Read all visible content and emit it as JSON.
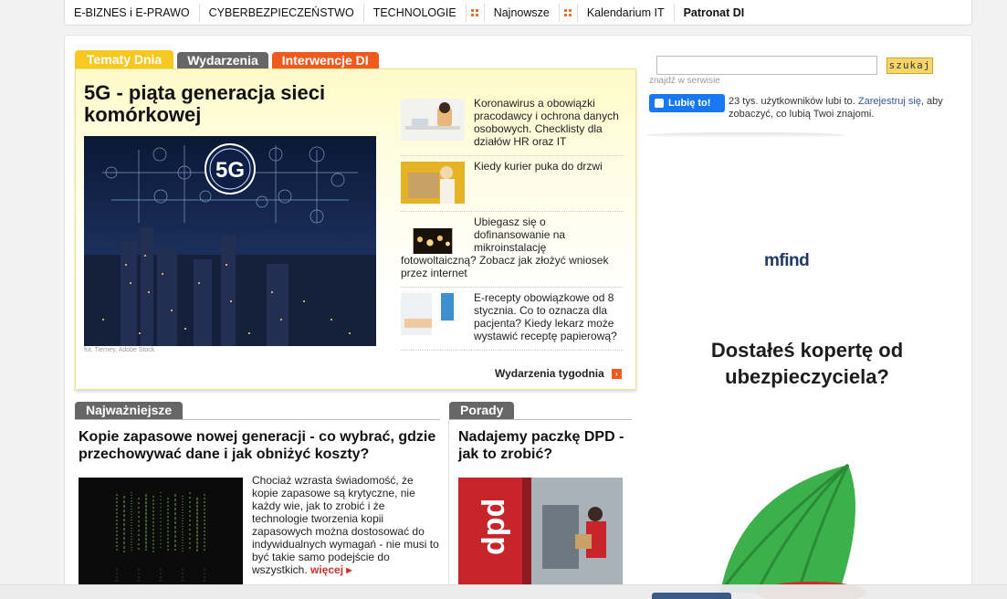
{
  "topnav": {
    "items": [
      "E-BIZNES i E-PRAWO",
      "CYBERBEZPIECZEŃSTWO",
      "TECHNOLOGIE",
      "Najnowsze",
      "Kalendarium IT",
      "Patronat DI"
    ]
  },
  "tabs": [
    "Tematy Dnia",
    "Wydarzenia",
    "Interwencje DI"
  ],
  "feature": {
    "title": "5G - piąta generacja sieci komórkowej",
    "image_text": "5G",
    "photo_credit": "fot. Tierney, Adobe Stock",
    "news": [
      "Koronawirus a obowiązki pracodawcy i ochrona danych osobowych. Checklisty dla działów HR oraz IT",
      "Kiedy kurier puka do drzwi",
      "Ubiegasz się o dofinansowanie na mikroinstalację fotowoltaiczną? Zobacz jak złożyć wniosek przez internet",
      "E-recepty obowiązkowe od 8 stycznia. Co to oznacza dla pacjenta? Kiedy lekarz może wystawić receptę papierową?"
    ],
    "weekly_link": "Wydarzenia tygodnia"
  },
  "najwazniejsze": {
    "label": "Najważniejsze",
    "title": "Kopie zapasowe nowej generacji - co wybrać, gdzie przechowywać dane i jak obniżyć koszty?",
    "text": "Chociaż wzrasta świadomość, że kopie zapasowe są krytyczne, nie każdy wie, jak to zrobić i że technologie tworzenia kopii zapasowych można dostosować do indywidualnych wymagań - nie musi to być takie samo podejście do wszystkich.",
    "more": "więcej"
  },
  "porady": {
    "label": "Porady",
    "title": "Nadajemy paczkę DPD - jak to zrobić?",
    "image_text": "dpd"
  },
  "sidebar": {
    "search_placeholder": "",
    "search_button": "szukaj",
    "search_hint": "znajdź w serwisie",
    "fb_button": "Lubię to!",
    "fb_text_before": "23 tys. użytkowników lubi to.",
    "fb_link": "Zarejestruj się",
    "fb_text_after": ", aby zobaczyć, co lubią Twoi znajomi."
  },
  "ad": {
    "logo": "mfind",
    "headline": "Dostałeś kopertę od ubezpieczyciela?"
  },
  "colors": {
    "tab_yellow": "#f7c820",
    "tab_gray": "#666666",
    "tab_orange": "#f05a1e",
    "fb_blue": "#1877f2",
    "more_red": "#d0302a"
  }
}
